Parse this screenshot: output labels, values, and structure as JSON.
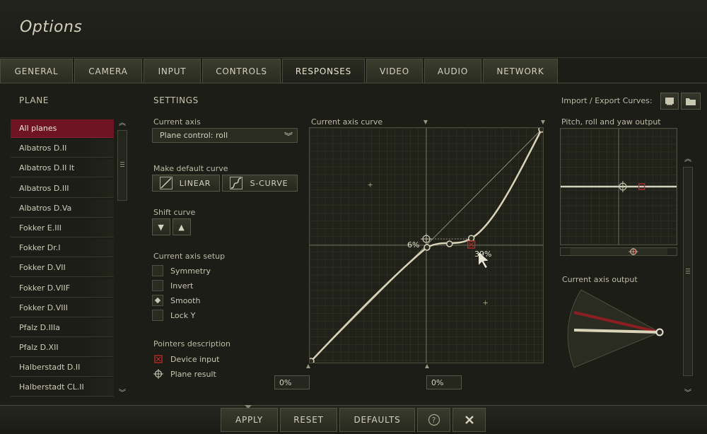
{
  "window": {
    "title": "Options"
  },
  "tabs": [
    {
      "label": "GENERAL",
      "active": false
    },
    {
      "label": "CAMERA",
      "active": false
    },
    {
      "label": "INPUT",
      "active": false
    },
    {
      "label": "CONTROLS",
      "active": false
    },
    {
      "label": "RESPONSES",
      "active": true
    },
    {
      "label": "VIDEO",
      "active": false
    },
    {
      "label": "AUDIO",
      "active": false
    },
    {
      "label": "NETWORK",
      "active": false
    }
  ],
  "plane_panel": {
    "heading": "PLANE",
    "items": [
      "All planes",
      "Albatros D.II",
      "Albatros D.II lt",
      "Albatros D.III",
      "Albatros D.Va",
      "Fokker E.III",
      "Fokker Dr.I",
      "Fokker D.VII",
      "Fokker D.VIIF",
      "Fokker D.VIII",
      "Pfalz D.IIIa",
      "Pfalz D.XII",
      "Halberstadt D.II",
      "Halberstadt CL.II"
    ],
    "selected": "All planes"
  },
  "settings": {
    "heading": "SETTINGS",
    "current_axis_label": "Current axis",
    "current_axis_value": "Plane control: roll",
    "make_default_label": "Make default curve",
    "linear_label": "LINEAR",
    "scurve_label": "S-CURVE",
    "shift_label": "Shift curve",
    "setup_label": "Current axis setup",
    "options": [
      {
        "label": "Symmetry",
        "checked": false
      },
      {
        "label": "Invert",
        "checked": false
      },
      {
        "label": "Smooth",
        "checked": true
      },
      {
        "label": "Lock Y",
        "checked": false
      }
    ],
    "pointers_label": "Pointers description",
    "device_input_label": "Device input",
    "plane_result_label": "Plane result"
  },
  "curve": {
    "label": "Current axis curve",
    "point_left_label": "6%",
    "point_right_label": "39%",
    "x_min_value": "0%",
    "x_mid_value": "0%"
  },
  "import_export": {
    "label": "Import / Export Curves:"
  },
  "output": {
    "pitch_roll_yaw_label": "Pitch, roll and yaw output",
    "axis_output_label": "Current axis output"
  },
  "footer": {
    "apply": "APPLY",
    "reset": "RESET",
    "defaults": "DEFAULTS"
  },
  "colors": {
    "accent_red": "#6e1422",
    "curve": "#d9d4b8",
    "device_input": "#b82b2b"
  }
}
